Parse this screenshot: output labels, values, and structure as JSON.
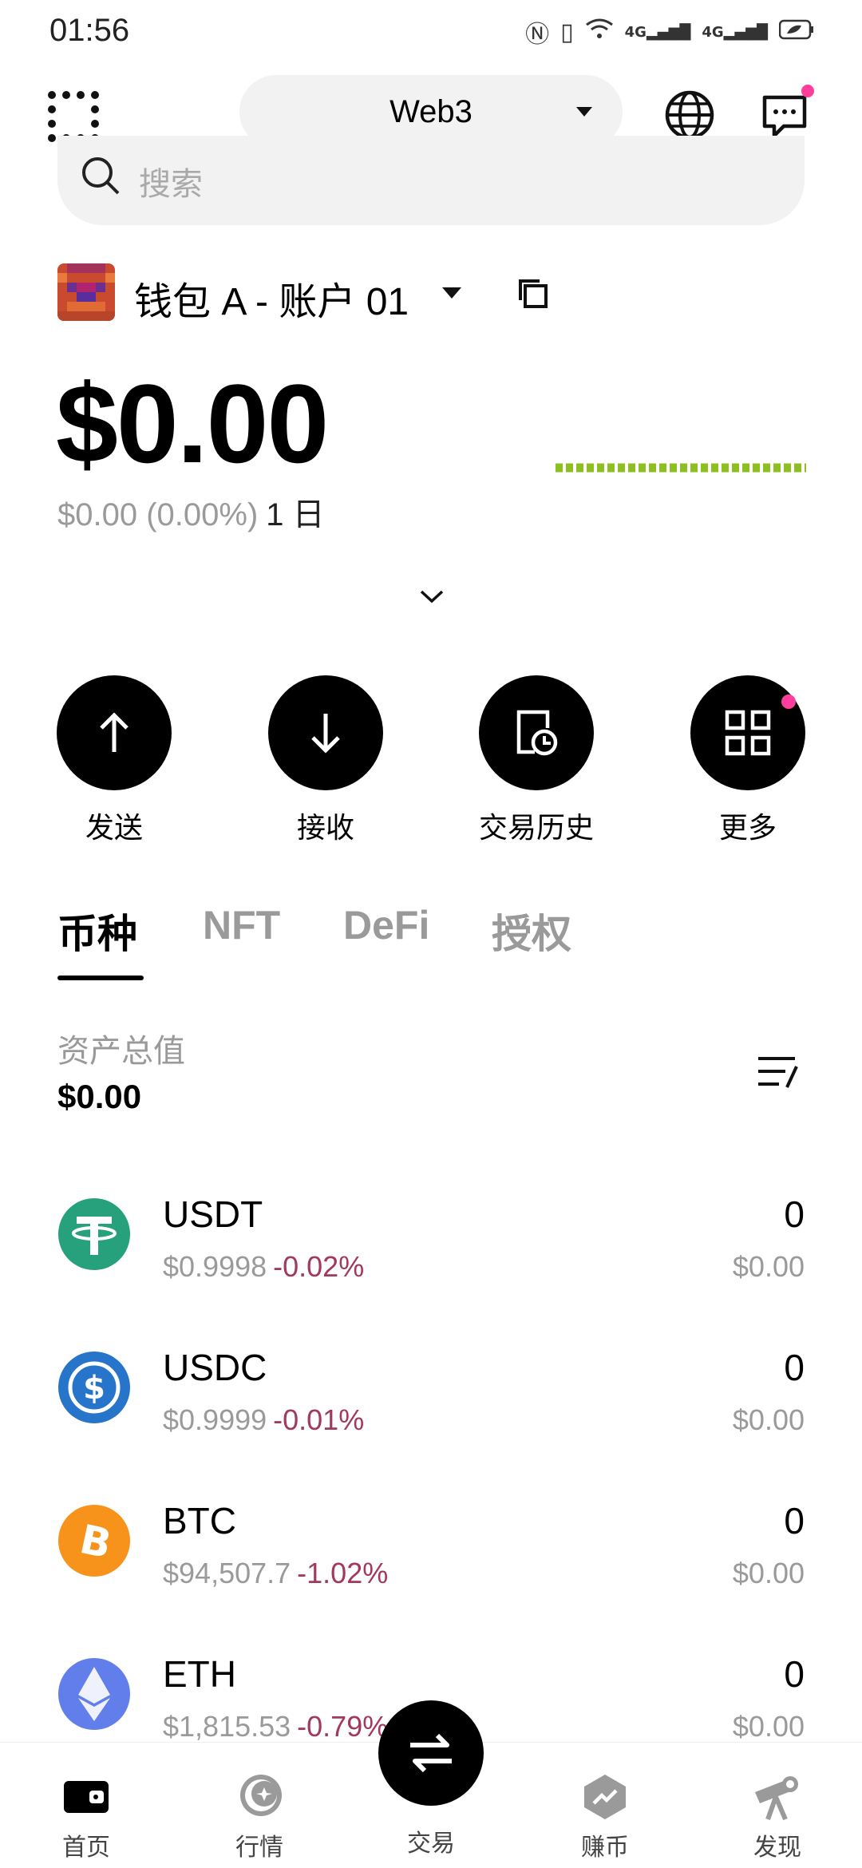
{
  "status_bar": {
    "time": "01:56",
    "network_1": "4G",
    "network_2": "4G"
  },
  "top_nav": {
    "mode_label": "Web3"
  },
  "search": {
    "placeholder": "搜索"
  },
  "account": {
    "name": "钱包 A - 账户 01"
  },
  "balance": {
    "total": "$0.00",
    "change": "$0.00 (0.00%)",
    "period": "1 日"
  },
  "actions": [
    {
      "label": "发送",
      "icon": "arrow-up-icon"
    },
    {
      "label": "接收",
      "icon": "arrow-down-icon"
    },
    {
      "label": "交易历史",
      "icon": "history-icon"
    },
    {
      "label": "更多",
      "icon": "grid-more-icon"
    }
  ],
  "tabs": [
    {
      "label": "币种",
      "active": true
    },
    {
      "label": "NFT",
      "active": false
    },
    {
      "label": "DeFi",
      "active": false
    },
    {
      "label": "授权",
      "active": false
    }
  ],
  "assets": {
    "total_label": "资产总值",
    "total_value": "$0.00"
  },
  "tokens": [
    {
      "symbol": "USDT",
      "price": "$0.9998",
      "change": "-0.02%",
      "amount": "0",
      "value": "$0.00",
      "color": "#26a17b"
    },
    {
      "symbol": "USDC",
      "price": "$0.9999",
      "change": "-0.01%",
      "amount": "0",
      "value": "$0.00",
      "color": "#2775ca"
    },
    {
      "symbol": "BTC",
      "price": "$94,507.7",
      "change": "-1.02%",
      "amount": "0",
      "value": "$0.00",
      "color": "#f7931a"
    },
    {
      "symbol": "ETH",
      "price": "$1,815.53",
      "change": "-0.79%",
      "amount": "0",
      "value": "$0.00",
      "color": "#627eea"
    }
  ],
  "bottom_nav": [
    {
      "label": "首页",
      "icon": "wallet-icon"
    },
    {
      "label": "行情",
      "icon": "market-icon"
    },
    {
      "label": "交易",
      "icon": "swap-icon"
    },
    {
      "label": "赚币",
      "icon": "earn-icon"
    },
    {
      "label": "发现",
      "icon": "discover-icon"
    }
  ],
  "colors": {
    "accent": "#000000",
    "negative": "#a3385e",
    "sparkline": "#8cbf1f",
    "notification": "#ff3d9a"
  }
}
